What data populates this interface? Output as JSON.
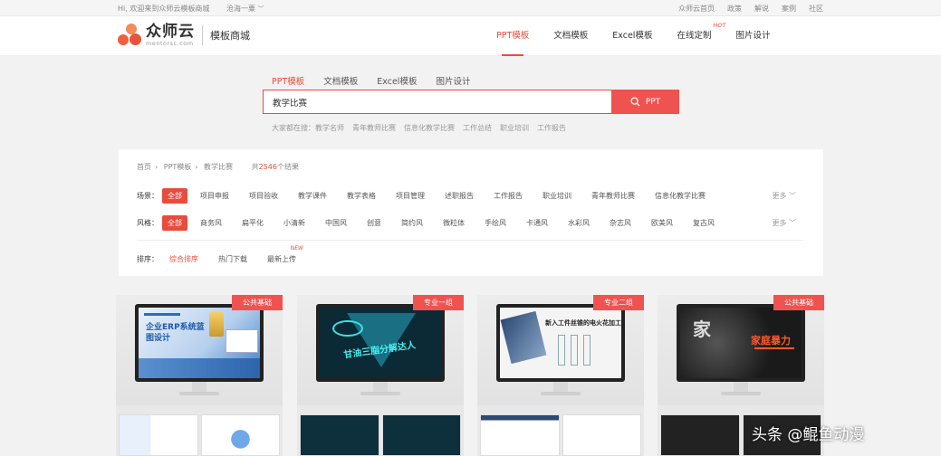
{
  "topbar": {
    "welcome": "Hi, 欢迎来到众师云模板商城",
    "city": "沧海一粟",
    "links": [
      "众师云首页",
      "政策",
      "解说",
      "案例",
      "社区"
    ]
  },
  "header": {
    "logo_cn": "众师云",
    "logo_en": "mentorsc.com",
    "logo_sub": "模板商城",
    "nav": [
      {
        "label": "PPT模板",
        "active": true
      },
      {
        "label": "文档模板",
        "active": false
      },
      {
        "label": "Excel模板",
        "active": false
      },
      {
        "label": "在线定制",
        "active": false,
        "badge": "HOT"
      },
      {
        "label": "图片设计",
        "active": false
      }
    ]
  },
  "search": {
    "tabs": [
      "PPT模板",
      "文档模板",
      "Excel模板",
      "图片设计"
    ],
    "active_tab": 0,
    "value": "教学比赛",
    "button_label": "PPT",
    "hot_label": "大家都在搜：",
    "hot_terms": [
      "教学名师",
      "青年教师比赛",
      "信息化教学比赛",
      "工作总结",
      "职业培训",
      "工作报告"
    ]
  },
  "breadcrumb": {
    "items": [
      "首页",
      "PPT模板",
      "教学比赛"
    ],
    "total_prefix": "共",
    "total_count": "2546",
    "total_suffix": "个结果"
  },
  "filters": {
    "scene": {
      "label": "场景：",
      "options": [
        "全部",
        "项目申报",
        "项目验收",
        "教学课件",
        "教学表格",
        "项目管理",
        "述职报告",
        "工作报告",
        "职业培训",
        "青年教师比赛",
        "信息化教学比赛"
      ],
      "more": "更多"
    },
    "style": {
      "label": "风格：",
      "options": [
        "全部",
        "商务风",
        "扁平化",
        "小清新",
        "中国风",
        "创意",
        "简约风",
        "微粒体",
        "手绘风",
        "卡通风",
        "水彩风",
        "杂志风",
        "欧美风",
        "复古风"
      ],
      "more": "更多"
    },
    "sort": {
      "label": "排序：",
      "options": [
        "综合排序",
        "热门下载",
        "最新上传"
      ],
      "new_badge": "NEW"
    }
  },
  "cards": [
    {
      "badge": "公共基础",
      "screen_title": "企业ERP系统蓝图设计",
      "color": "#2a6fb5"
    },
    {
      "badge": "专业一组",
      "screen_title": "甘油三脂分解达人",
      "color": "#0b2a36"
    },
    {
      "badge": "专业二组",
      "screen_title": "新入工件丝锥的电火花加工",
      "color": "#f4f4f4"
    },
    {
      "badge": "公共基础",
      "screen_title": "家庭暴力",
      "color": "#1a1a1a"
    }
  ],
  "watermark": "头条 @鲲鱼动漫"
}
